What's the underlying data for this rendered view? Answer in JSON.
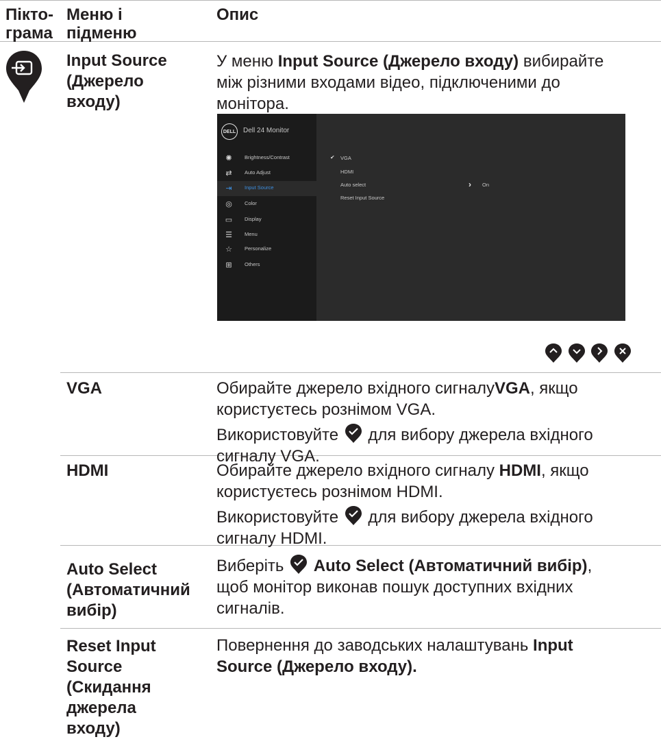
{
  "header": {
    "col1_line1": "Пікто-",
    "col1_line2": "грама",
    "col2_line1": "Меню і",
    "col2_line2": "підменю",
    "col3": "Опис"
  },
  "main_item": {
    "icon": "input-source-icon",
    "name_lines": [
      "Input Source",
      "(Джерело",
      "входу)"
    ],
    "desc": {
      "pre": "У меню ",
      "bold": "Input Source (Джерело входу)",
      "post": " вибирайте",
      "line2": "між різними входами відео, підключеними до",
      "line3": "монітора."
    }
  },
  "osd": {
    "title": "Dell 24 Monitor",
    "logo": "DELL",
    "menu": [
      {
        "icon": "brightness-icon",
        "label": "Brightness/Contrast"
      },
      {
        "icon": "auto-adjust-icon",
        "label": "Auto Adjust"
      },
      {
        "icon": "input-source-icon",
        "label": "Input Source"
      },
      {
        "icon": "color-icon",
        "label": "Color"
      },
      {
        "icon": "display-icon",
        "label": "Display"
      },
      {
        "icon": "menu-icon",
        "label": "Menu"
      },
      {
        "icon": "personalize-icon",
        "label": "Personalize"
      },
      {
        "icon": "others-icon",
        "label": "Others"
      }
    ],
    "options": [
      "VGA",
      "HDMI",
      "Auto select",
      "Reset Input Source"
    ],
    "auto_select_value": "On",
    "accent": "#3d8fe0"
  },
  "nav_buttons": [
    "up-button-icon",
    "down-button-icon",
    "right-button-icon",
    "close-button-icon"
  ],
  "rows": {
    "vga": {
      "name": "VGA",
      "d1_pre": "Обирайте джерело вхідного сигналу",
      "d1_bold": "VGA",
      "d1_post": ", якщо",
      "d2": "користуєтесь рознімом VGA.",
      "d3_pre": "Використовуйте",
      "d3_post": "для вибору джерела вхідного",
      "d4": "сигналу VGA."
    },
    "hdmi": {
      "name": "HDMI",
      "d1_pre": "Обирайте джерело вхідного сигналу ",
      "d1_bold": "HDMI",
      "d1_post": ", якщо",
      "d2": "користуєтесь рознімом HDMI.",
      "d3_pre": "Використовуйте",
      "d3_post": "для вибору джерела вхідного",
      "d4": "сигналу HDMI."
    },
    "auto": {
      "name_lines": [
        "Auto Select",
        "(Автоматичний",
        "вибір)"
      ],
      "d1_pre": "Виберіть",
      "d1_bold": "Auto Select (Автоматичний вибір)",
      "d1_post": ",",
      "d2": "щоб монітор виконав пошук доступних вхідних",
      "d3": "сигналів."
    },
    "reset": {
      "name_lines": [
        "Reset Input",
        "Source",
        "(Скидання",
        "джерела",
        "входу)"
      ],
      "d1": "Повернення до заводських налаштувань ",
      "d1_bold": "Input",
      "d2_bold": "Source (Джерело входу)."
    }
  },
  "colors": {
    "pin": "#231f20",
    "rule": "#b7b7b7",
    "osd_bg": "#2b2b2b",
    "osd_side": "#1b1b1b"
  }
}
